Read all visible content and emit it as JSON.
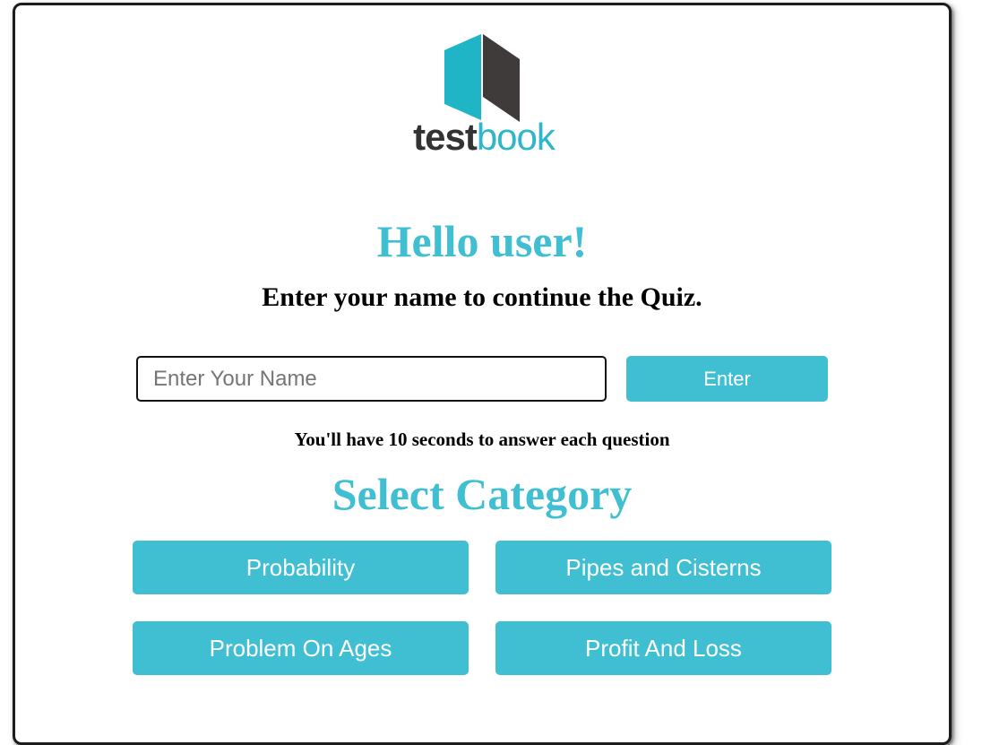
{
  "logo": {
    "text_part1": "test",
    "text_part2": "book",
    "colors": {
      "teal": "#1fb5c6",
      "dark": "#3f3b3a"
    }
  },
  "greeting": {
    "title": "Hello user!",
    "subtitle": "Enter your name to continue the Quiz."
  },
  "name_form": {
    "placeholder": "Enter Your Name",
    "value": "",
    "button_label": "Enter"
  },
  "timer_note": "You'll have 10 seconds to answer each question",
  "categories": {
    "title": "Select Category",
    "items": [
      {
        "label": "Probability"
      },
      {
        "label": "Pipes and Cisterns"
      },
      {
        "label": "Problem On Ages"
      },
      {
        "label": "Profit And Loss"
      }
    ]
  },
  "colors": {
    "accent": "#3fbfd1",
    "text": "#000000"
  }
}
